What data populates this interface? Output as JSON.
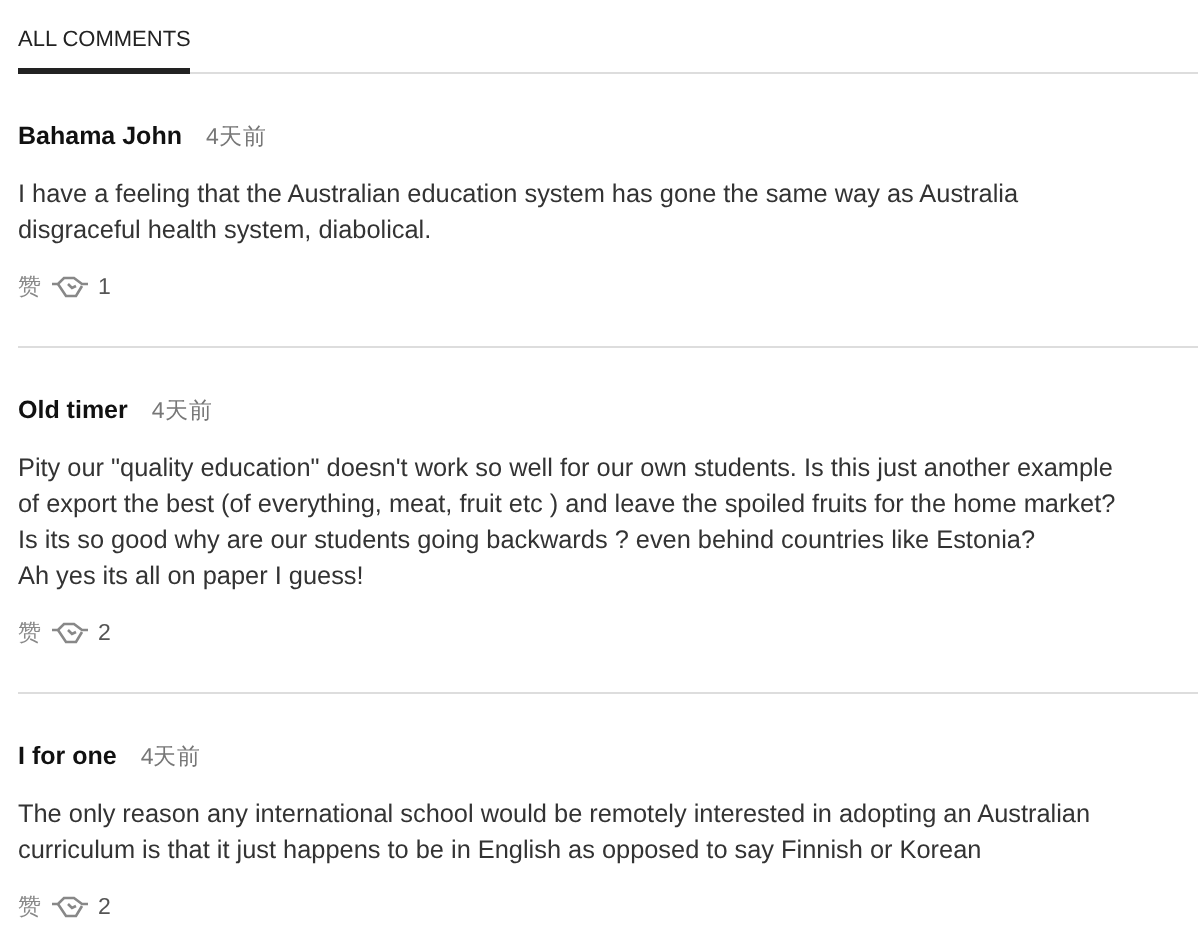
{
  "tabs": [
    {
      "label": "ALL COMMENTS",
      "selected": true
    }
  ],
  "comments": [
    {
      "author": "Bahama John",
      "time": "4天前",
      "lines": [
        "I have a feeling that the Australian education system has gone the same way as Australia",
        "disgraceful health system, diabolical."
      ],
      "like_label": "赞",
      "count": "1"
    },
    {
      "author": "Old timer",
      "time": "4天前",
      "lines": [
        "Pity our \"quality education\" doesn't work so well for our own students. Is this just another example",
        "of export the best (of everything, meat, fruit etc ) and leave the spoiled fruits for the home market?",
        "Is its so good why are our students going backwards ? even behind countries like Estonia?",
        "Ah yes its all on paper I guess!"
      ],
      "like_label": "赞",
      "count": "2"
    },
    {
      "author": "I for one",
      "time": "4天前",
      "lines": [
        "The only reason any international school would be remotely interested in adopting an Australian",
        "curriculum is that it just happens to be in English as opposed to say Finnish or Korean"
      ],
      "like_label": "赞",
      "count": "2"
    }
  ]
}
